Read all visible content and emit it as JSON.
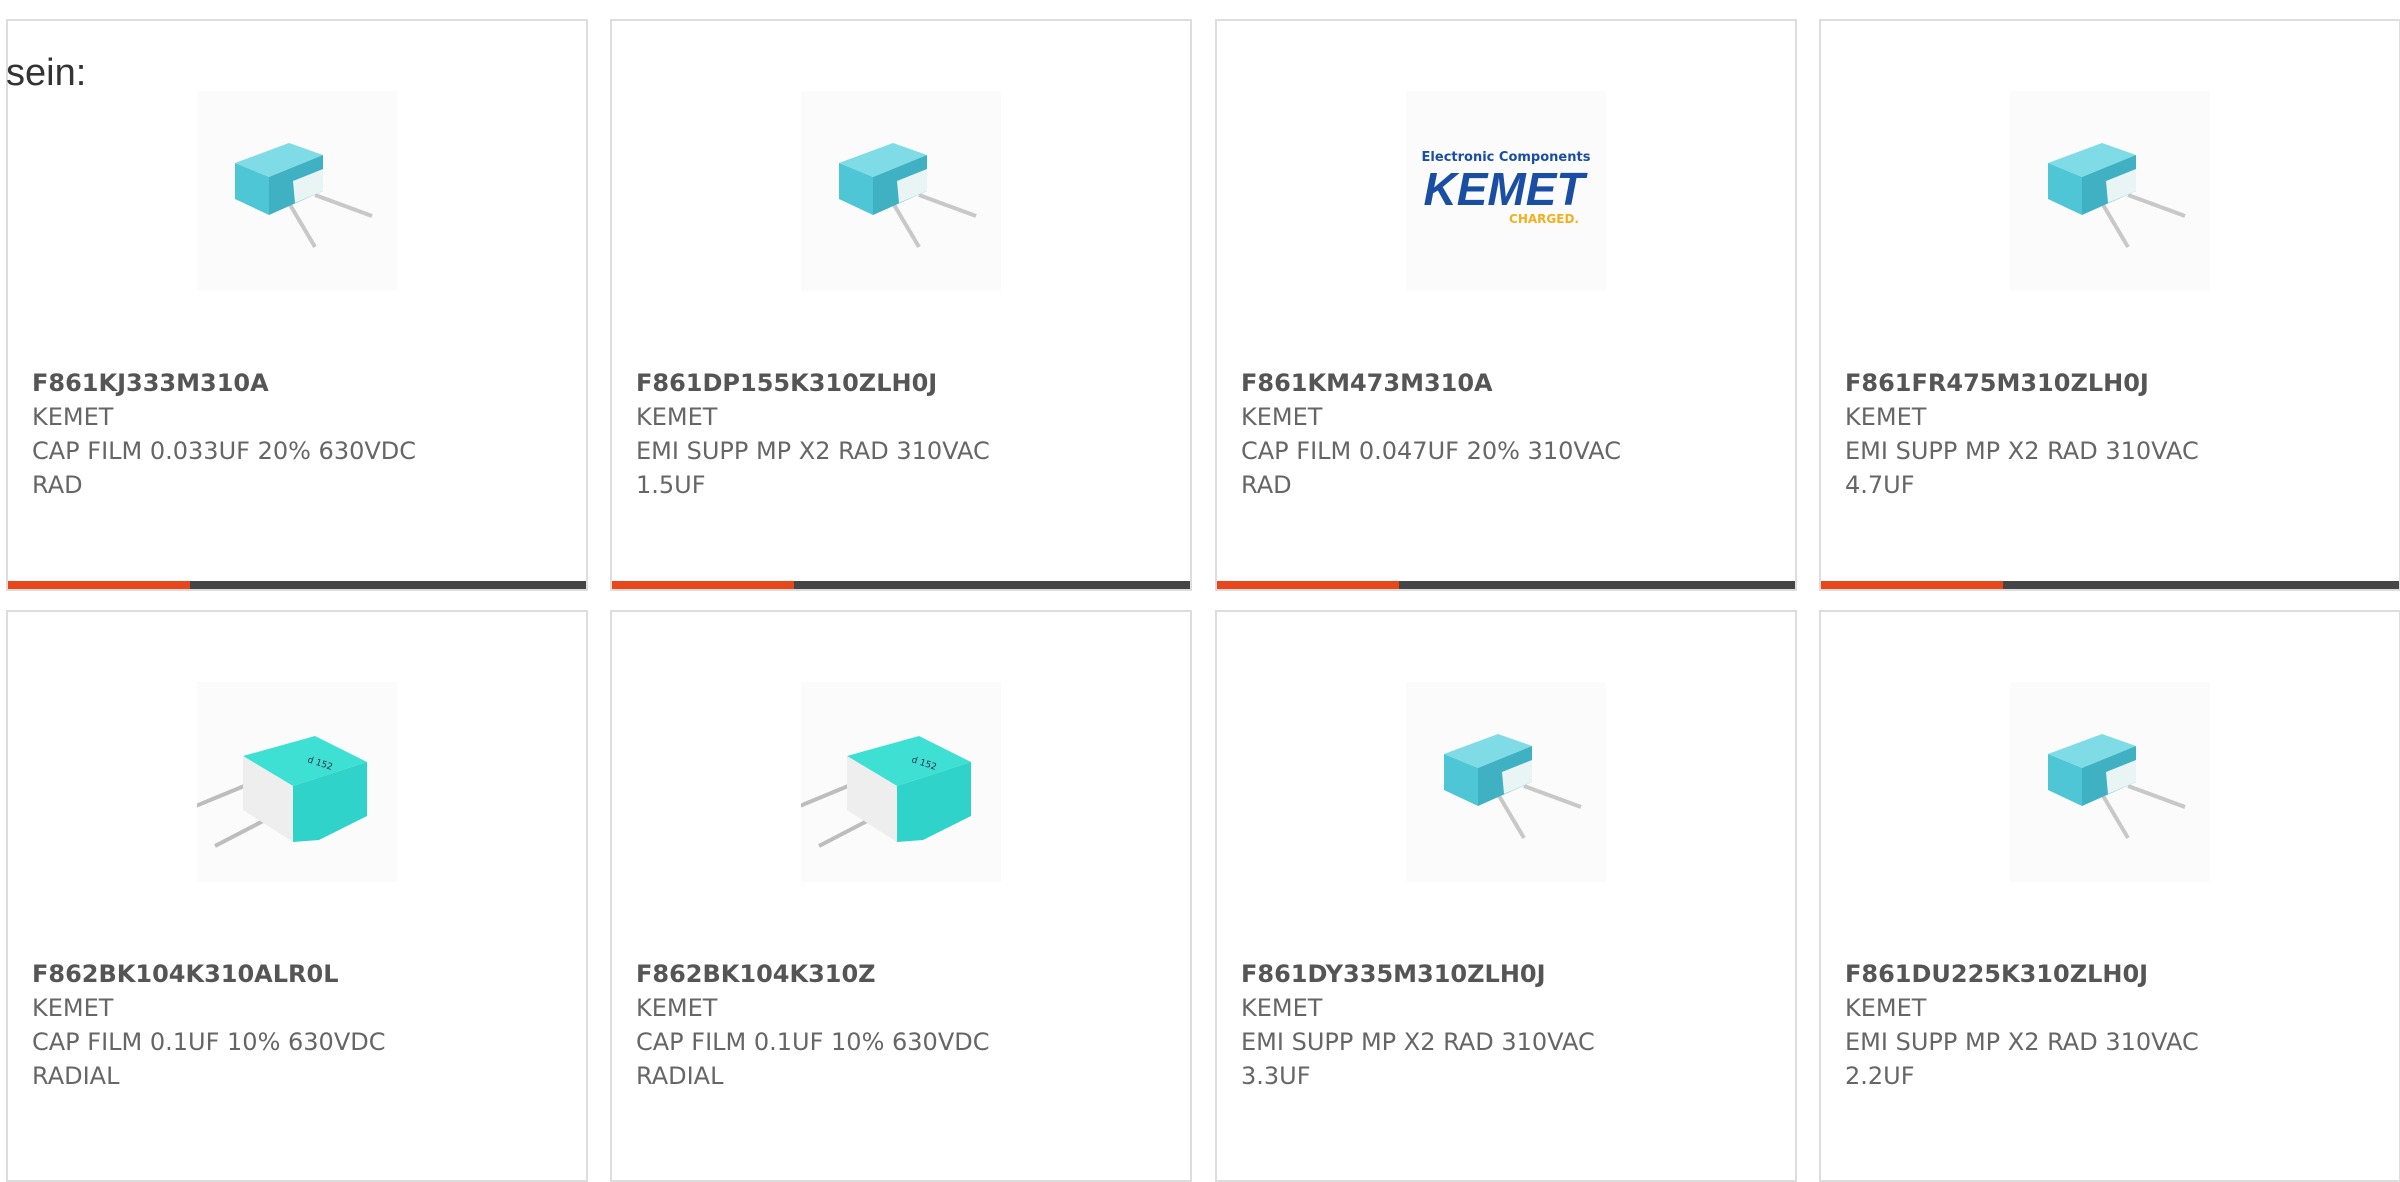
{
  "intro_text": "sein:",
  "products": [
    {
      "part": "F861KJ333M310A",
      "maker": "KEMET",
      "desc": "CAP FILM 0.033UF 20% 630VDC RAD",
      "image": "capacitor-blue-small"
    },
    {
      "part": "F861DP155K310ZLH0J",
      "maker": "KEMET",
      "desc": "EMI SUPP MP X2 RAD 310VAC 1.5UF",
      "image": "capacitor-blue-small"
    },
    {
      "part": "F861KM473M310A",
      "maker": "KEMET",
      "desc": "CAP FILM 0.047UF 20% 310VAC RAD",
      "image": "kemet-logo",
      "logo": {
        "tagline": "Electronic Components",
        "brand": "KEMET",
        "sub": "CHARGED."
      }
    },
    {
      "part": "F861FR475M310ZLH0J",
      "maker": "KEMET",
      "desc": "EMI SUPP MP X2 RAD 310VAC 4.7UF",
      "image": "capacitor-blue-small"
    },
    {
      "part": "F862BK104K310ALR0L",
      "maker": "KEMET",
      "desc": "CAP FILM 0.1UF 10% 630VDC RADIAL",
      "image": "capacitor-teal-large"
    },
    {
      "part": "F862BK104K310Z",
      "maker": "KEMET",
      "desc": "CAP FILM 0.1UF 10% 630VDC RADIAL",
      "image": "capacitor-teal-large"
    },
    {
      "part": "F861DY335M310ZLH0J",
      "maker": "KEMET",
      "desc": "EMI SUPP MP X2 RAD 310VAC 3.3UF",
      "image": "capacitor-blue-small"
    },
    {
      "part": "F861DU225K310ZLH0J",
      "maker": "KEMET",
      "desc": "EMI SUPP MP X2 RAD 310VAC 2.2UF",
      "image": "capacitor-blue-small"
    }
  ],
  "colors": {
    "accent": "#e8471c",
    "bar": "#454545",
    "capacitor_blue": "#4fc6d6",
    "capacitor_teal": "#2fd3c9",
    "logo_blue": "#1a4ea3",
    "logo_gold": "#f2b01e"
  }
}
